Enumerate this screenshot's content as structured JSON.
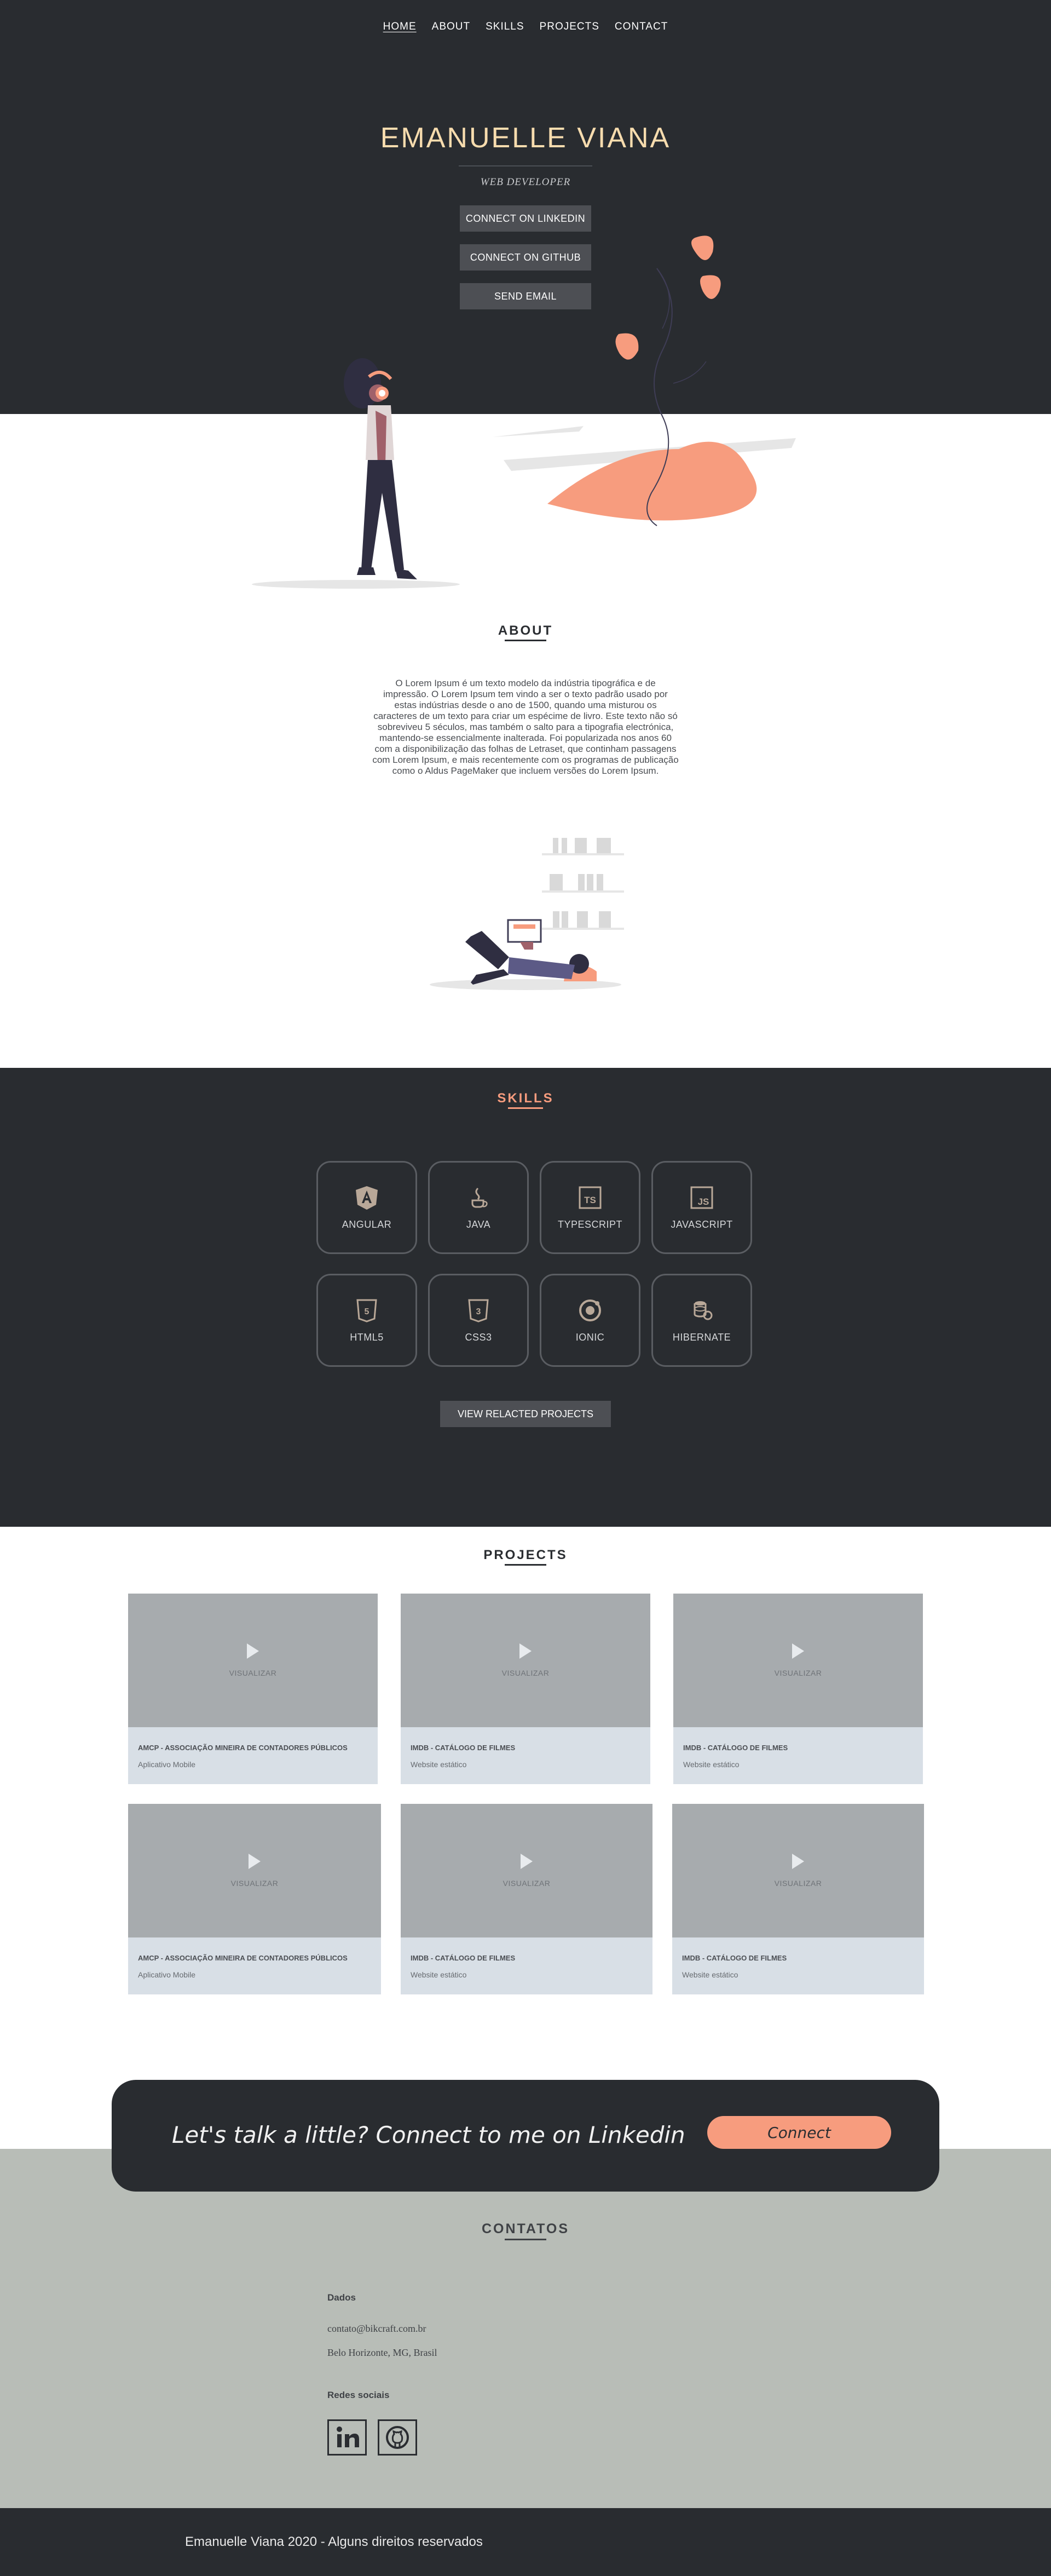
{
  "nav": {
    "items": [
      "HOME",
      "ABOUT",
      "SKILLS",
      "PROJECTS",
      "CONTACT"
    ],
    "active": "HOME"
  },
  "hero": {
    "name": "EMANUELLE VIANA",
    "role": "WEB DEVELOPER",
    "buttons": [
      "CONNECT ON LINKEDIN",
      "CONNECT ON GITHUB",
      "SEND EMAIL"
    ]
  },
  "about": {
    "title": "ABOUT",
    "text": "O Lorem Ipsum é um texto modelo da indústria tipográfica e de impressão. O Lorem Ipsum tem vindo a ser o texto padrão usado por estas indústrias desde o ano de 1500, quando uma misturou os caracteres de um texto para criar um espécime de livro. Este texto não só sobreviveu 5 séculos, mas também o salto para a tipografia electrónica, mantendo-se essencialmente inalterada. Foi popularizada nos anos 60 com a disponibilização das folhas de Letraset, que continham passagens com Lorem Ipsum, e mais recentemente com os programas de publicação como o Aldus PageMaker que incluem versões do Lorem Ipsum."
  },
  "skills": {
    "title": "SKILLS",
    "items": [
      {
        "label": "ANGULAR",
        "icon": "angular-icon"
      },
      {
        "label": "JAVA",
        "icon": "java-icon"
      },
      {
        "label": "TYPESCRIPT",
        "icon": "typescript-icon"
      },
      {
        "label": "JAVASCRIPT",
        "icon": "javascript-icon"
      },
      {
        "label": "HTML5",
        "icon": "html5-icon"
      },
      {
        "label": "CSS3",
        "icon": "css3-icon"
      },
      {
        "label": "IONIC",
        "icon": "ionic-icon"
      },
      {
        "label": "HIBERNATE",
        "icon": "hibernate-icon"
      }
    ],
    "button": "VIEW RELACTED PROJECTS"
  },
  "projects": {
    "title": "PROJECTS",
    "items": [
      {
        "visualize": "VISUALIZAR",
        "title": "AMCP - ASSOCIAÇÃO MINEIRA DE CONTADORES PÚBLICOS",
        "subtitle": "Aplicativo Mobile"
      },
      {
        "visualize": "VISUALIZAR",
        "title": "IMDB - CATÁLOGO DE FILMES",
        "subtitle": "Website estático"
      },
      {
        "visualize": "VISUALIZAR",
        "title": "IMDB - CATÁLOGO DE FILMES",
        "subtitle": "Website estático"
      },
      {
        "visualize": "VISUALIZAR",
        "title": "AMCP - ASSOCIAÇÃO MINEIRA DE CONTADORES PÚBLICOS",
        "subtitle": "Aplicativo Mobile"
      },
      {
        "visualize": "VISUALIZAR",
        "title": "IMDB - CATÁLOGO DE FILMES",
        "subtitle": "Website estático"
      },
      {
        "visualize": "VISUALIZAR",
        "title": "IMDB - CATÁLOGO DE FILMES",
        "subtitle": "Website estático"
      }
    ]
  },
  "cta": {
    "text": "Let's talk a little? Connect to me on Linkedin",
    "button": "Connect"
  },
  "contatos": {
    "title": "CONTATOS",
    "dados_label": "Dados",
    "email": "contato@bikcraft.com.br",
    "location": "Belo Horizonte, MG, Brasil",
    "social_label": "Redes sociais",
    "socials": [
      "linkedin-icon",
      "github-icon"
    ]
  },
  "footer": {
    "text": "Emanuelle Viana 2020 - Alguns direitos reservados"
  },
  "colors": {
    "dark": "#292c30",
    "accent": "#f79c7e",
    "name": "#f7dcae",
    "contact_bg": "#b8bdb7",
    "card": "#d8dfe6",
    "thumb": "#a7abae"
  }
}
